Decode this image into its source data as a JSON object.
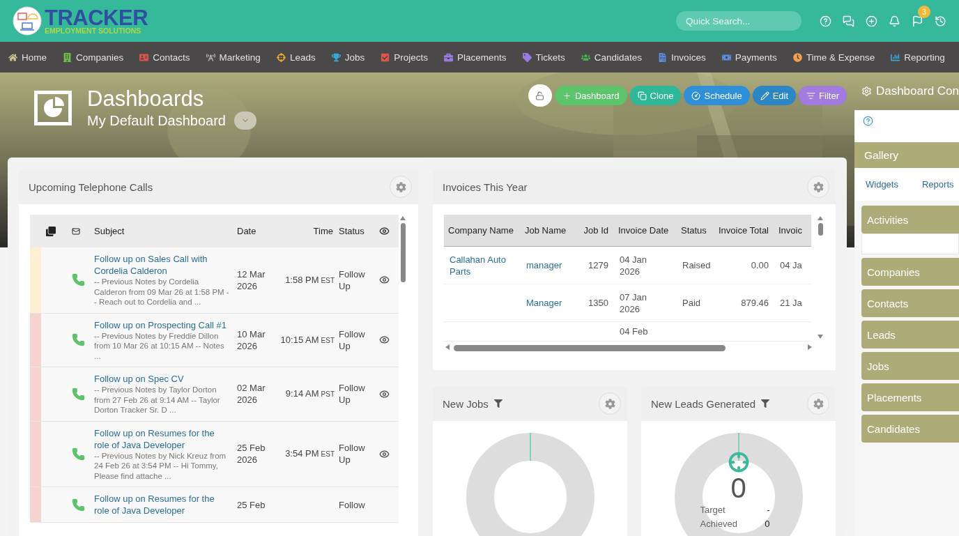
{
  "logo": {
    "title": "TRACKER",
    "subtitle": "EMPLOYMENT SOLUTIONS"
  },
  "search": {
    "placeholder": "Quick Search..."
  },
  "flag_badge": "3",
  "nav": [
    {
      "label": "Home",
      "color": "#c9c28e"
    },
    {
      "label": "Companies",
      "color": "#6cc04a"
    },
    {
      "label": "Contacts",
      "color": "#e0554a"
    },
    {
      "label": "Marketing",
      "color": "#bbbbbb"
    },
    {
      "label": "Leads",
      "color": "#f0a830"
    },
    {
      "label": "Jobs",
      "color": "#3aa6d8"
    },
    {
      "label": "Projects",
      "color": "#e0554a"
    },
    {
      "label": "Placements",
      "color": "#9a7be0"
    },
    {
      "label": "Tickets",
      "color": "#9a7be0"
    },
    {
      "label": "Candidates",
      "color": "#4caf50"
    },
    {
      "label": "Invoices",
      "color": "#5b8de0"
    },
    {
      "label": "Payments",
      "color": "#5b8de0"
    },
    {
      "label": "Time & Expense",
      "color": "#f0a050"
    },
    {
      "label": "Reporting",
      "color": "#3aa6d8"
    }
  ],
  "header": {
    "title": "Dashboards",
    "subtitle": "My Default Dashboard"
  },
  "actions": [
    {
      "label": "Dashboard",
      "color": "#5cc46a"
    },
    {
      "label": "Clone",
      "color": "#2db89a"
    },
    {
      "label": "Schedule",
      "color": "#2f8fd8"
    },
    {
      "label": "Edit",
      "color": "#2a86c4"
    },
    {
      "label": "Filter",
      "color": "#a07be0"
    }
  ],
  "calls": {
    "title": "Upcoming Telephone Calls",
    "columns": [
      "Subject",
      "Date",
      "Time",
      "Status"
    ],
    "rows": [
      {
        "color": "#fdf0d2",
        "subject": "Follow up on Sales Call with Cordelia Calderon",
        "notes": "-- Previous Notes by Cordelia Calderon from 09 Mar 26 at 1:58 PM -- Reach out to Cordelia and ...",
        "date": "12 Mar 2026",
        "time": "1:58 PM",
        "zone": "EST",
        "status": "Follow Up"
      },
      {
        "color": "#f6d3cf",
        "subject": "Follow up on Prospecting Call #1",
        "notes": "-- Previous Notes by Freddie Dillon from 10 Mar 26 at 10:15 AM -- Notes ...",
        "date": "10 Mar 2026",
        "time": "10:15 AM",
        "zone": "EST",
        "status": "Follow Up"
      },
      {
        "color": "#f6d3cf",
        "subject": "Follow up on Spec CV",
        "notes": "-- Previous Notes by Taylor Dorton from 27 Feb 26 at 9:14 AM -- Taylor Dorton Tracker Sr. D ...",
        "date": "02 Mar 2026",
        "time": "9:14 AM",
        "zone": "PST",
        "status": "Follow Up"
      },
      {
        "color": "#f6d3cf",
        "subject": "Follow up on Resumes for the role of Java Developer",
        "notes": "-- Previous Notes by Nick Kreuz from 24 Feb 26 at 3:54 PM -- Hi Tommy, Please find attache ...",
        "date": "25 Feb 2026",
        "time": "3:54 PM",
        "zone": "EST",
        "status": "Follow Up"
      },
      {
        "color": "#f6d3cf",
        "subject": "Follow up on Resumes for the role of Java Developer",
        "date": "25 Feb",
        "status": "Follow"
      }
    ]
  },
  "invoices": {
    "title": "Invoices This Year",
    "columns": [
      "Company Name",
      "Job Name",
      "Job Id",
      "Invoice Date",
      "Status",
      "Invoice Total",
      "Invoic"
    ],
    "rows": [
      {
        "company": "Callahan Auto Parts",
        "job": "manager",
        "job_id": "1279",
        "date": "04 Jan 2026",
        "status": "Raised",
        "total": "0.00",
        "col_7": "04 Ja"
      },
      {
        "job": "Manager",
        "job_id": "1350",
        "date": "07 Jan 2026",
        "status": "Paid",
        "total": "879.46",
        "col_7": "21 Ja"
      },
      {
        "date": "04 Feb"
      }
    ]
  },
  "new_jobs": {
    "title": "New Jobs"
  },
  "new_leads": {
    "title": "New Leads Generated",
    "value": "0",
    "target_label": "Target",
    "target": "-",
    "achieved_label": "Achieved",
    "achieved": "0"
  },
  "config": {
    "title": "Dashboard Con",
    "gallery": "Gallery",
    "tabs": [
      "Widgets",
      "Reports"
    ],
    "categories": [
      "Activities",
      "Companies",
      "Contacts",
      "Leads",
      "Jobs",
      "Placements",
      "Candidates"
    ]
  }
}
